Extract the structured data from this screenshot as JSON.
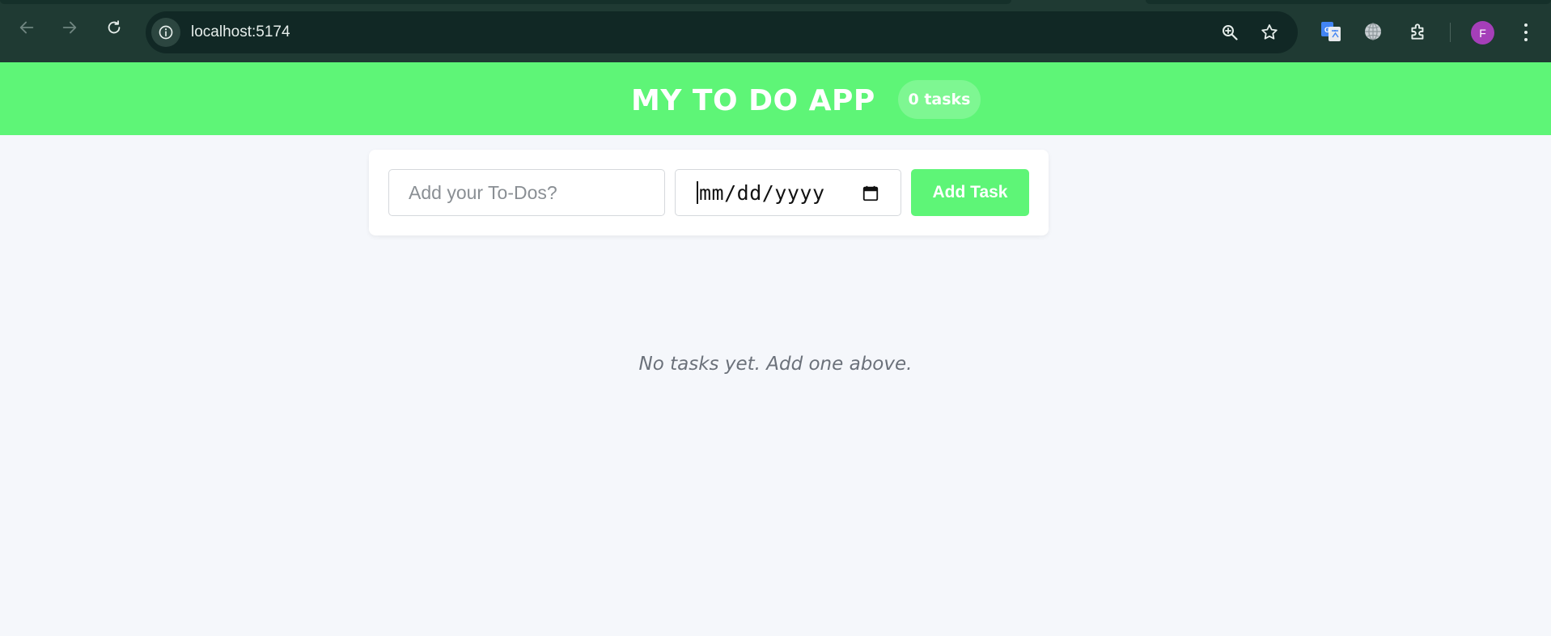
{
  "browser": {
    "url": "localhost:5174",
    "profile_initial": "F",
    "icons": [
      "back-arrow-icon",
      "forward-arrow-icon",
      "reload-icon",
      "info-icon",
      "zoom-icon",
      "star-icon",
      "google-translate-icon",
      "globe-icon",
      "extensions-icon",
      "more-menu-icon"
    ]
  },
  "header": {
    "title": "MY TO DO APP",
    "task_count": "0 tasks"
  },
  "form": {
    "todo_placeholder": "Add your To-Dos?",
    "date_value": "mm/dd/yyyy",
    "add_button": "Add Task"
  },
  "tasks": {
    "empty_message": "No tasks yet. Add one above."
  },
  "colors": {
    "accent": "#5ef577",
    "chrome_bg": "#1f3a33",
    "page_bg": "#f5f7fb"
  }
}
